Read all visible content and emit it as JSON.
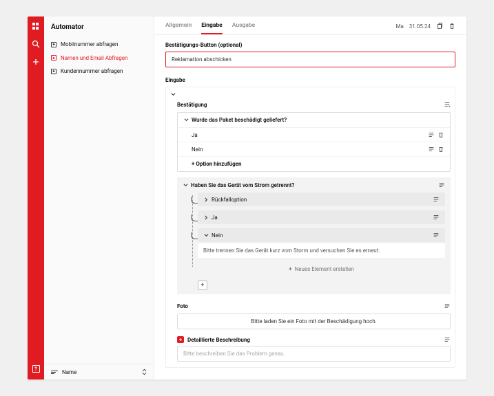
{
  "sidebar": {
    "title": "Automator",
    "items": [
      {
        "label": "Mobilnummer abfragen",
        "active": false
      },
      {
        "label": "Namen und Email Abfragen",
        "active": true
      },
      {
        "label": "Kundennummer abfragen",
        "active": false
      }
    ],
    "sort_label": "Name"
  },
  "tabs": [
    {
      "label": "Allgemein",
      "active": false
    },
    {
      "label": "Eingabe",
      "active": true
    },
    {
      "label": "Ausgabe",
      "active": false
    }
  ],
  "top_date_prefix": "Ma",
  "top_date": "31.05.24",
  "confirm_section_label": "Bestätigungs-Button (optional)",
  "confirm_value": "Reklamation abschicken",
  "input_section_label": "Eingabe",
  "bestaet": {
    "title": "Bestätigung",
    "question": "Wurde das Paket beschädigt geliefert?",
    "options": [
      "Ja",
      "Nein"
    ],
    "add_option": "+ Option hinzufügen"
  },
  "strom": {
    "question": "Haben Sie das Gerät vom Strom getrennt?",
    "fallback": "Rückfalloption",
    "yes": "Ja",
    "no": "Nein",
    "no_body": "Bitte trennen Sie das Gerät kurz vom Storm und versuchen Sie es erneut.",
    "new_element": "Neues Element erstellen"
  },
  "foto": {
    "title": "Foto",
    "body": "Bitte laden Sie ein Foto mit der Beschädigung hoch."
  },
  "detail": {
    "title": "Detaillierte Beschreibung",
    "placeholder": "Bitte beschreiben Sie das Problem genau."
  }
}
